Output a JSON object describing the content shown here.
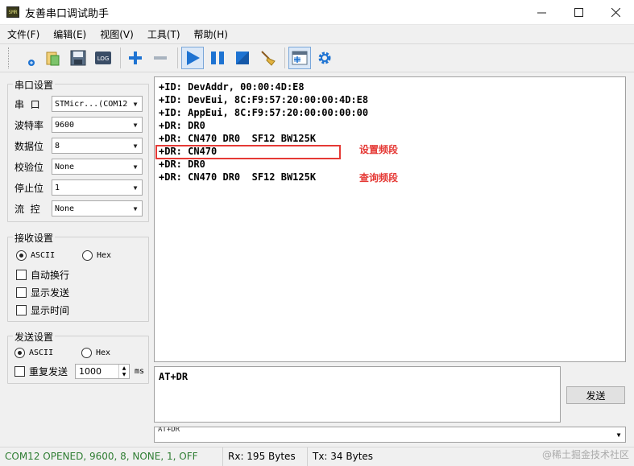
{
  "window": {
    "title": "友善串口调试助手",
    "app_icon_text": "SMR"
  },
  "menu": [
    "文件(F)",
    "编辑(E)",
    "视图(V)",
    "工具(T)",
    "帮助(H)"
  ],
  "toolbar": {
    "log_label": "LOG"
  },
  "serial_settings": {
    "title": "串口设置",
    "rows": [
      {
        "label": "串  口",
        "value": "STMicr...(COM12"
      },
      {
        "label": "波特率",
        "value": "9600"
      },
      {
        "label": "数据位",
        "value": "8"
      },
      {
        "label": "校验位",
        "value": "None"
      },
      {
        "label": "停止位",
        "value": "1"
      },
      {
        "label": "流  控",
        "value": "None"
      }
    ]
  },
  "receive_settings": {
    "title": "接收设置",
    "ascii": "ASCII",
    "hex": "Hex",
    "auto_newline": "自动换行",
    "show_send": "显示发送",
    "show_time": "显示时间"
  },
  "send_settings": {
    "title": "发送设置",
    "ascii": "ASCII",
    "hex": "Hex",
    "repeat": "重复发送",
    "interval": "1000",
    "unit": "ms"
  },
  "output_lines": [
    "+ID: DevAddr, 00:00:4D:E8",
    "+ID: DevEui, 8C:F9:57:20:00:00:4D:E8",
    "+ID: AppEui, 8C:F9:57:20:00:00:00:00",
    "+DR: DR0",
    "+DR: CN470 DR0  SF12 BW125K",
    "+DR: CN470",
    "+DR: DR0",
    "+DR: CN470 DR0  SF12 BW125K"
  ],
  "annotations": {
    "set_band": "设置频段",
    "query_band": "查询频段"
  },
  "input_text": "AT+DR",
  "send_button": "发送",
  "history_value": "AT+DR",
  "status": {
    "port": "COM12 OPENED, 9600, 8, NONE, 1, OFF",
    "rx": "Rx: 195 Bytes",
    "tx": "Tx: 34 Bytes"
  },
  "watermark": "@稀土掘金技术社区",
  "colors": {
    "status_green": "#2e7d32",
    "annotation_red": "#e53935",
    "toolbar_blue": "#1e73d2"
  }
}
